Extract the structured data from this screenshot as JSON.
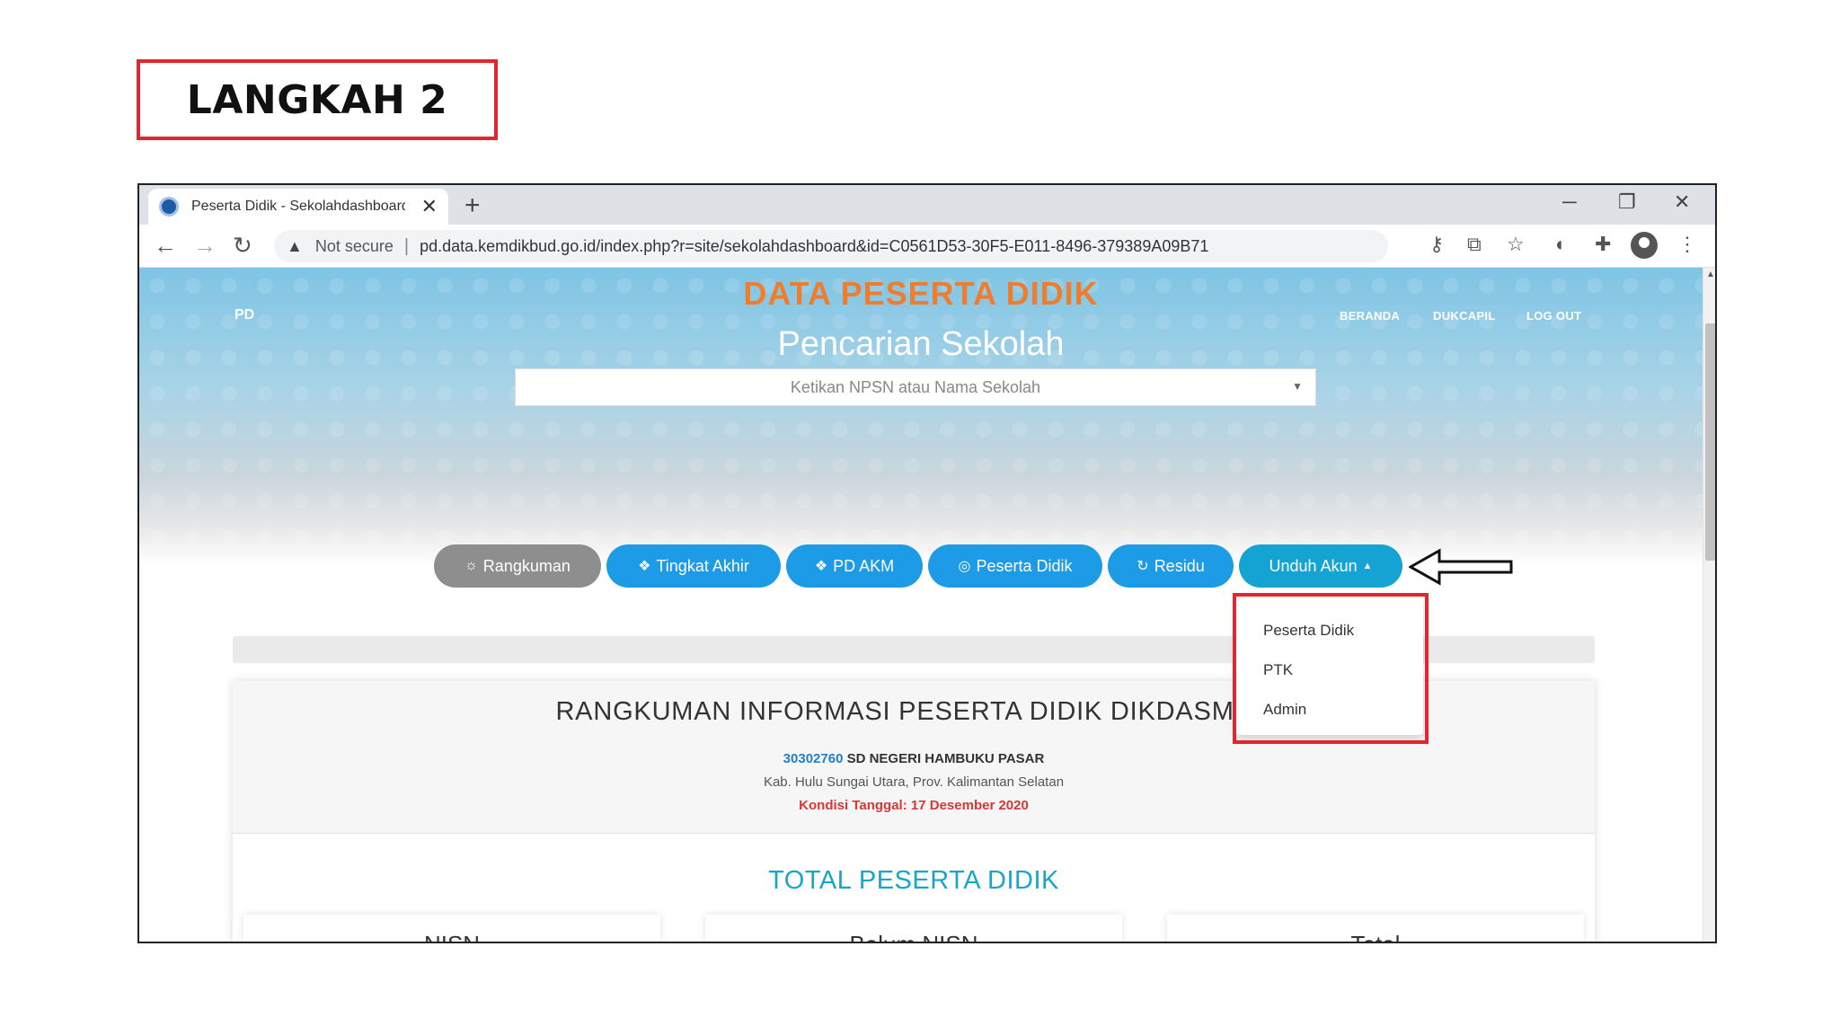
{
  "step_label": "LANGKAH 2",
  "browser": {
    "tab_title": "Peserta Didik - Sekolahdashboard",
    "new_tab_symbol": "+",
    "close_tab_symbol": "✕",
    "not_secure_label": "Not secure",
    "url": "pd.data.kemdikbud.go.id/index.php?r=site/sekolahdashboard&id=C0561D53-30F5-E011-8496-379389A09B71"
  },
  "page": {
    "hero_title": "DATA PESERTA DIDIK",
    "logo_text": "PD",
    "nav": [
      "BERANDA",
      "DUKCAPIL",
      "LOG OUT"
    ],
    "search": {
      "title": "Pencarian Sekolah",
      "placeholder": "Ketikan NPSN atau Nama Sekolah"
    },
    "buttons": [
      "Rangkuman",
      "Tingkat Akhir",
      "PD AKM",
      "Peserta Didik",
      "Residu",
      "Unduh Akun"
    ],
    "dropdown": [
      "Peserta Didik",
      "PTK",
      "Admin"
    ],
    "summary": {
      "title": "RANGKUMAN INFORMASI PESERTA DIDIK DIKDASMEN",
      "npsn": "30302760",
      "school_name": "SD NEGERI HAMBUKU PASAR",
      "address": "Kab. Hulu Sungai Utara, Prov. Kalimantan Selatan",
      "kondisi": "Kondisi Tanggal: 17 Desember 2020"
    },
    "total_title": "TOTAL PESERTA DIDIK",
    "stat_cards": [
      "NISN",
      "Belum NISN",
      "Total"
    ]
  },
  "colors": {
    "annotation_red": "#e3262d",
    "hero_orange": "#f07d2c",
    "button_blue": "#1e9be6",
    "total_teal": "#1aa5c7"
  }
}
